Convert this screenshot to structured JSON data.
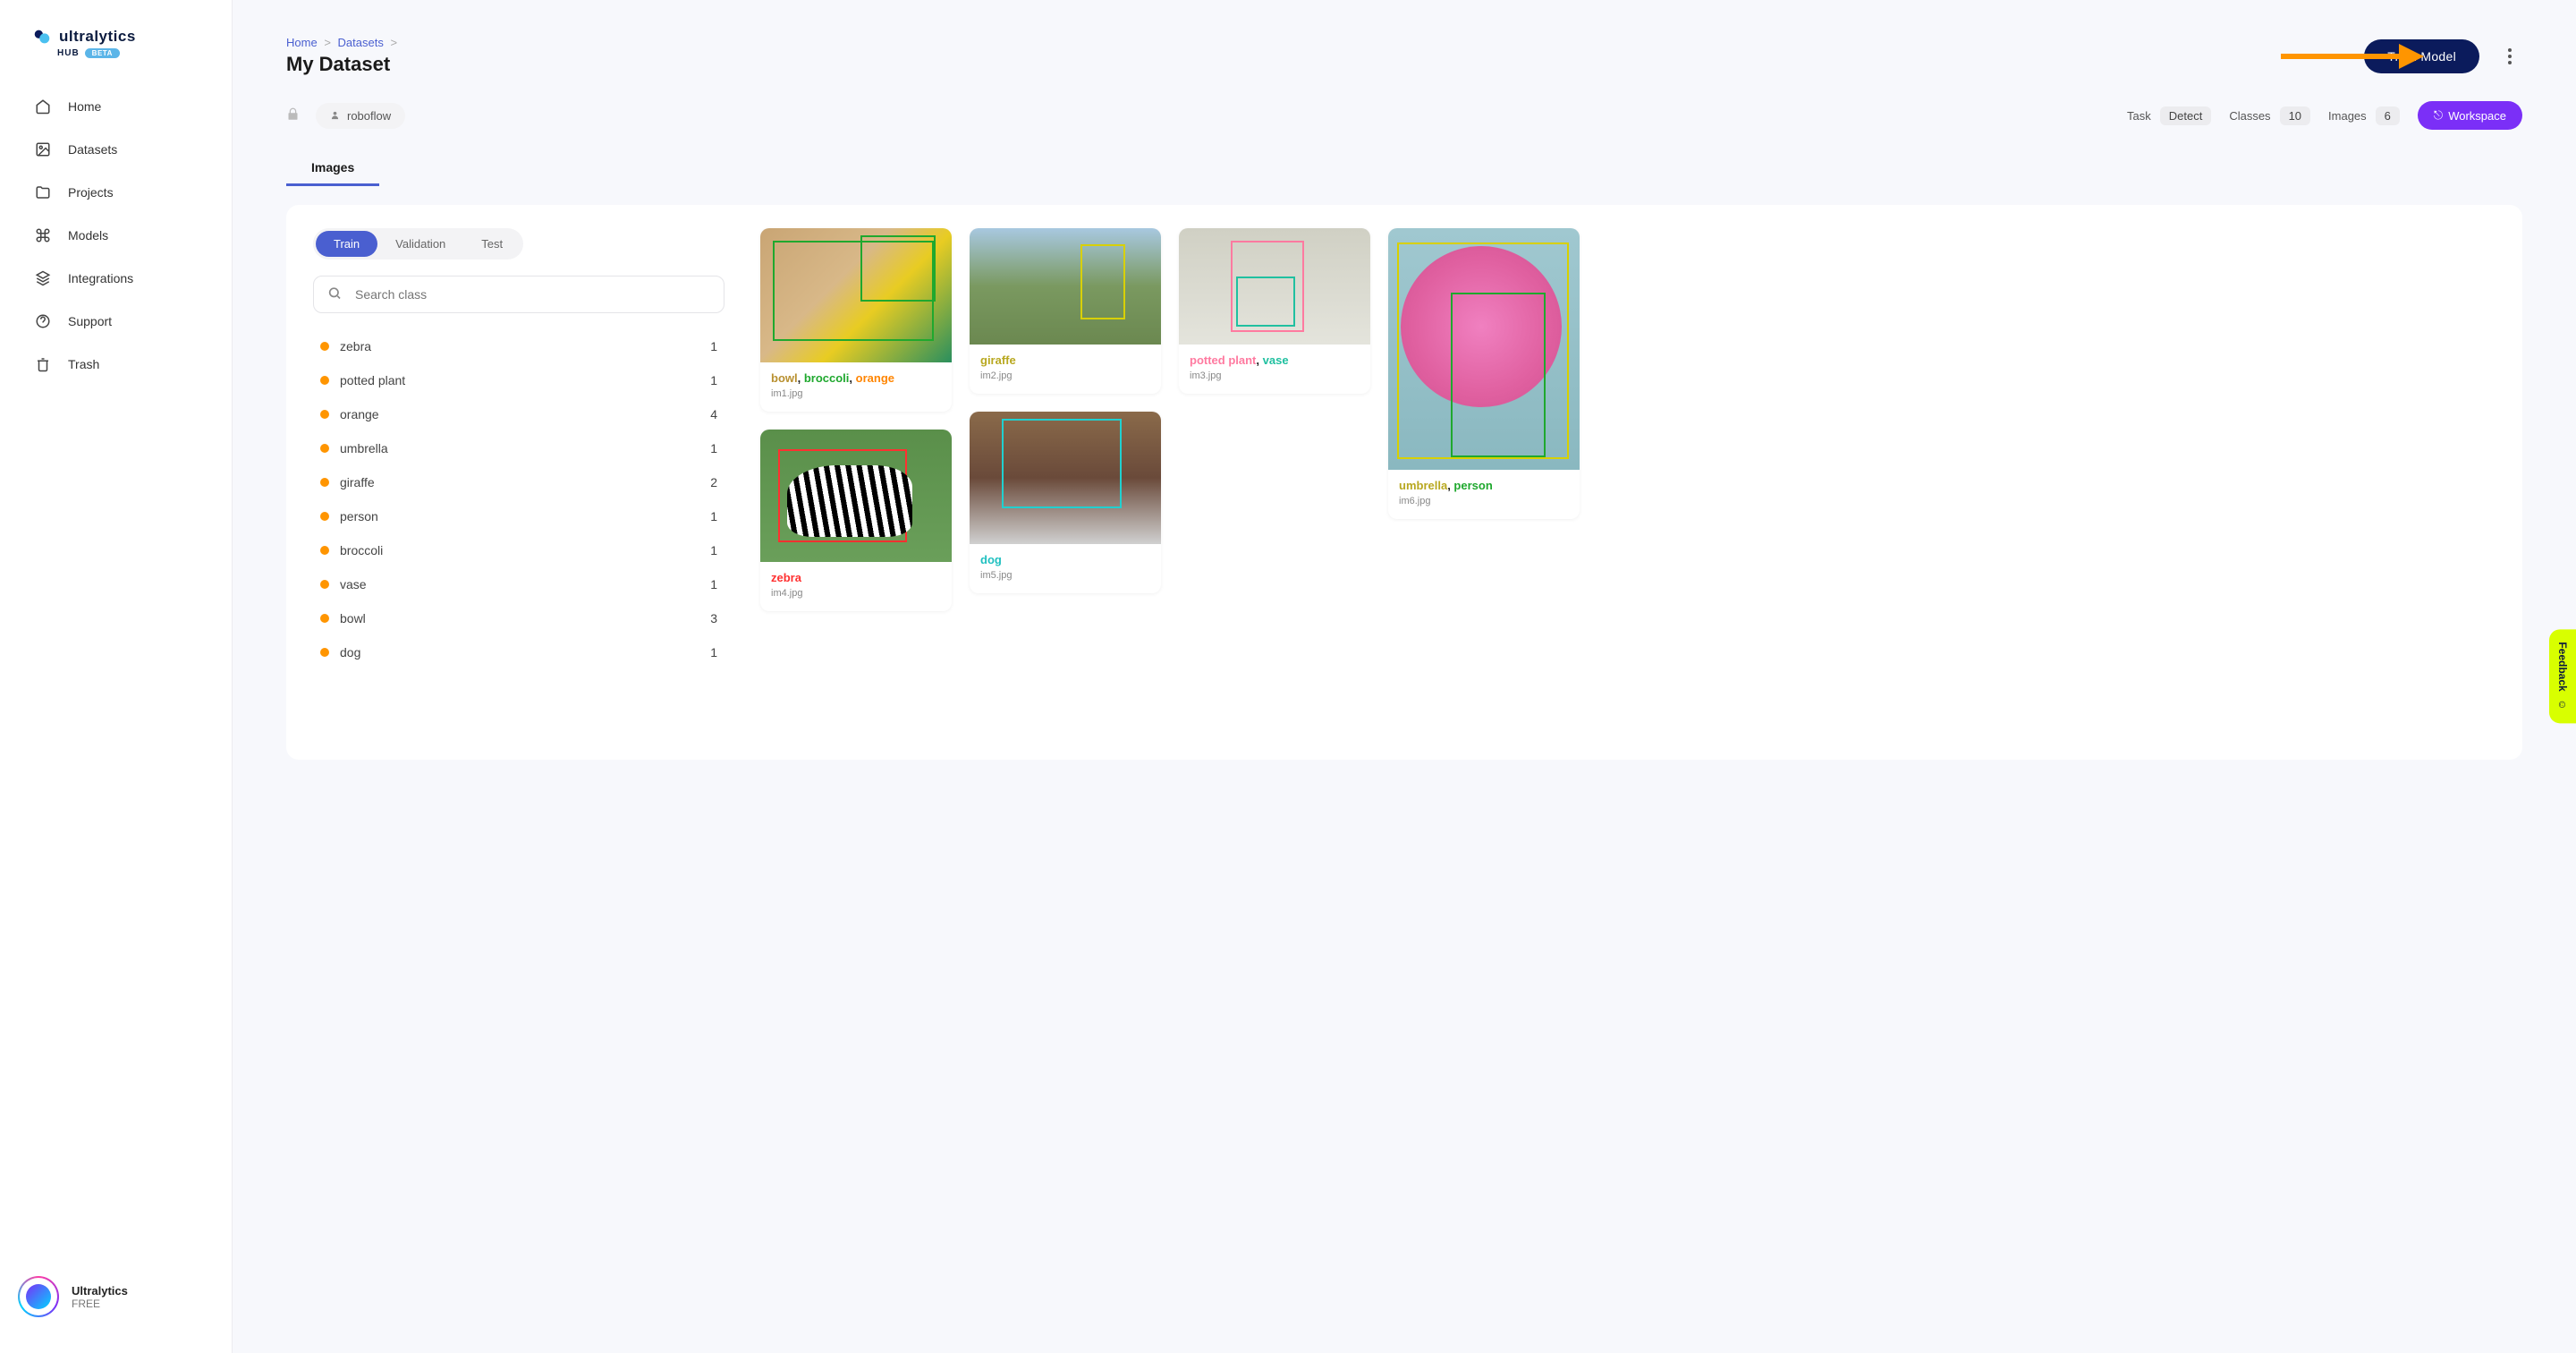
{
  "brand": {
    "name": "ultralytics",
    "sub": "HUB",
    "tag": "BETA"
  },
  "nav": {
    "home": "Home",
    "datasets": "Datasets",
    "projects": "Projects",
    "models": "Models",
    "integrations": "Integrations",
    "support": "Support",
    "trash": "Trash"
  },
  "footer": {
    "name": "Ultralytics",
    "plan": "FREE"
  },
  "breadcrumb": {
    "home": "Home",
    "datasets": "Datasets"
  },
  "page_title": "My Dataset",
  "train_button": "Train Model",
  "owner": "roboflow",
  "stats": {
    "task_label": "Task",
    "task_value": "Detect",
    "classes_label": "Classes",
    "classes_value": "10",
    "images_label": "Images",
    "images_value": "6"
  },
  "workspace_btn": "Workspace",
  "main_tab": "Images",
  "splits": {
    "train": "Train",
    "validation": "Validation",
    "test": "Test"
  },
  "search_placeholder": "Search class",
  "classes": [
    {
      "name": "zebra",
      "count": "1"
    },
    {
      "name": "potted plant",
      "count": "1"
    },
    {
      "name": "orange",
      "count": "4"
    },
    {
      "name": "umbrella",
      "count": "1"
    },
    {
      "name": "giraffe",
      "count": "2"
    },
    {
      "name": "person",
      "count": "1"
    },
    {
      "name": "broccoli",
      "count": "1"
    },
    {
      "name": "vase",
      "count": "1"
    },
    {
      "name": "bowl",
      "count": "3"
    },
    {
      "name": "dog",
      "count": "1"
    }
  ],
  "images": {
    "im1": {
      "file": "im1.jpg",
      "labels": [
        {
          "t": "bowl",
          "c": "lbl-bowl"
        },
        {
          "t": ", "
        },
        {
          "t": "broccoli",
          "c": "lbl-broccoli"
        },
        {
          "t": ", "
        },
        {
          "t": "orange",
          "c": "lbl-orange"
        }
      ]
    },
    "im2": {
      "file": "im2.jpg",
      "labels": [
        {
          "t": "giraffe",
          "c": "lbl-giraffe"
        }
      ]
    },
    "im3": {
      "file": "im3.jpg",
      "labels": [
        {
          "t": "potted plant",
          "c": "lbl-potted"
        },
        {
          "t": ", "
        },
        {
          "t": "vase",
          "c": "lbl-vase"
        }
      ]
    },
    "im4": {
      "file": "im4.jpg",
      "labels": [
        {
          "t": "zebra",
          "c": "lbl-zebra"
        }
      ]
    },
    "im5": {
      "file": "im5.jpg",
      "labels": [
        {
          "t": "dog",
          "c": "lbl-dog"
        }
      ]
    },
    "im6": {
      "file": "im6.jpg",
      "labels": [
        {
          "t": "umbrella",
          "c": "lbl-umbrella"
        },
        {
          "t": ", "
        },
        {
          "t": "person",
          "c": "lbl-person"
        }
      ]
    }
  },
  "feedback": "Feedback"
}
